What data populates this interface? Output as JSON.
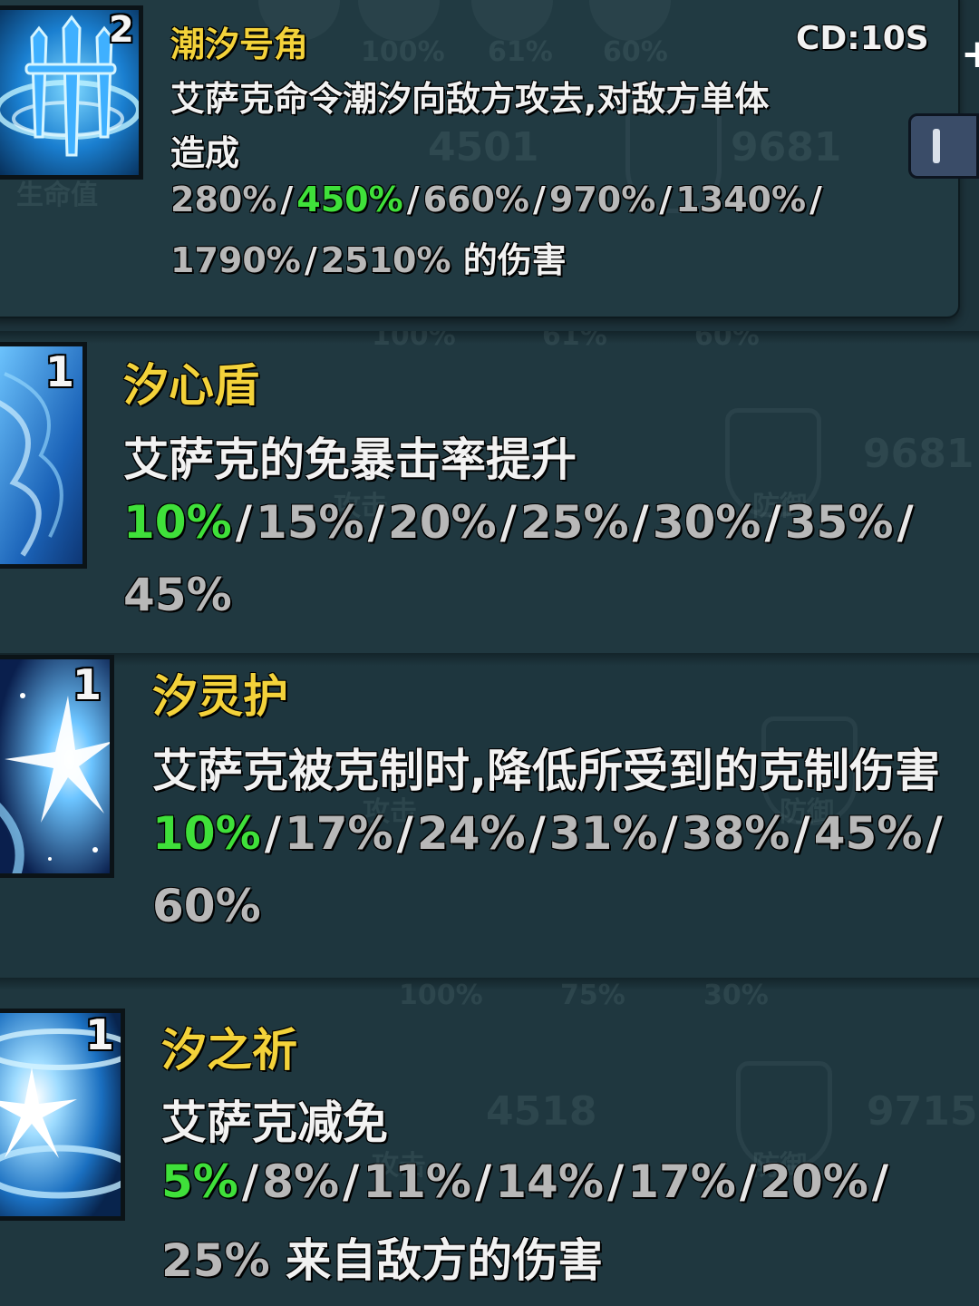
{
  "cooldown": "CD:10S",
  "skills": [
    {
      "level": "2",
      "name": "潮汐号角",
      "desc_lines": [
        "艾萨克命令潮汐向敌方攻去,对敌方单体",
        "造成"
      ],
      "value_lines": [
        [
          "280%",
          "450%",
          "660%",
          "970%",
          "1340%"
        ],
        [
          "1790%",
          "2510%"
        ]
      ],
      "active_value": "450%",
      "suffix": "的伤害",
      "icon": "trident-icon"
    },
    {
      "level": "1",
      "name": "汐心盾",
      "desc_lines": [
        "艾萨克的免暴击率提升"
      ],
      "value_lines": [
        [
          "10%",
          "15%",
          "20%",
          "25%",
          "30%",
          "35%"
        ],
        [
          "45%"
        ]
      ],
      "active_value": "10%",
      "suffix": "",
      "icon": "water-shield-icon"
    },
    {
      "level": "1",
      "name": "汐灵护",
      "desc_lines": [
        "艾萨克被克制时,降低所受到的克制伤害"
      ],
      "value_lines": [
        [
          "10%",
          "17%",
          "24%",
          "31%",
          "38%",
          "45%"
        ],
        [
          "60%"
        ]
      ],
      "active_value": "10%",
      "suffix": "",
      "icon": "spirit-burst-icon"
    },
    {
      "level": "1",
      "name": "汐之祈",
      "desc_lines": [
        "艾萨克减免"
      ],
      "value_lines": [
        [
          "5%",
          "8%",
          "11%",
          "14%",
          "17%",
          "20%"
        ],
        [
          "25%"
        ]
      ],
      "active_value": "5%",
      "suffix": "来自敌方的伤害",
      "icon": "tide-prayer-icon"
    }
  ],
  "background_ghost": {
    "bars": [
      "100%",
      "61%",
      "60%",
      "100%",
      "75%",
      "30%"
    ],
    "stats": [
      "4501",
      "9681",
      "9681",
      "4518",
      "9715"
    ],
    "labels": [
      "生命值",
      "攻击",
      "防御"
    ]
  },
  "colors": {
    "name": "#f3d23a",
    "active_value": "#3fe03a",
    "inactive_value": "#b8b8b8",
    "panel": "#213a42"
  }
}
